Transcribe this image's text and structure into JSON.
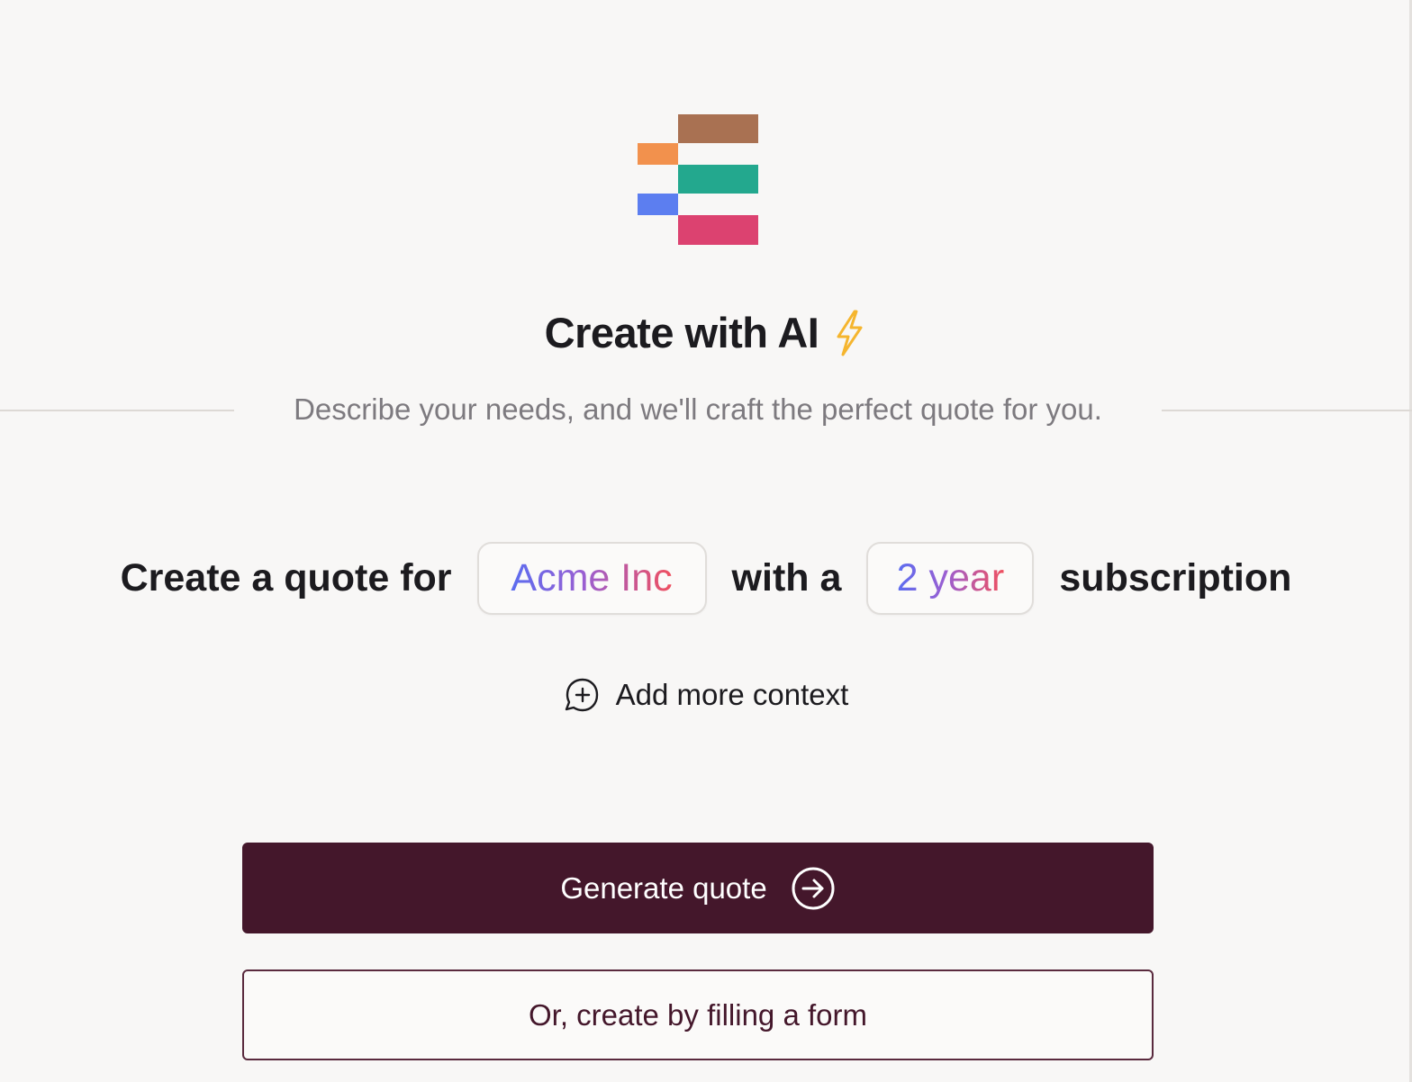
{
  "logo": {
    "colors": [
      "#a97152",
      "#f2914d",
      "#23a88e",
      "#5c7ef0",
      "#dc4270"
    ]
  },
  "header": {
    "title": "Create with AI",
    "title_icon": "lightning-bolt-icon",
    "subtitle": "Describe your needs, and we'll craft the perfect quote for you."
  },
  "prompt": {
    "prefix": "Create a quote for",
    "company_value": "Acme Inc",
    "connector": "with a",
    "term_value": "2 year",
    "suffix": "subscription"
  },
  "context": {
    "icon": "chat-add-icon",
    "label": "Add more context"
  },
  "actions": {
    "generate_label": "Generate quote",
    "generate_icon": "arrow-right-circle-icon",
    "form_label": "Or, create by filling a form"
  },
  "colors": {
    "primary": "#44172b",
    "background": "#f8f7f6",
    "accent_gradient": [
      "#5b6df0",
      "#9a5fd2",
      "#f0505f"
    ],
    "bolt": "#f5b52e"
  }
}
